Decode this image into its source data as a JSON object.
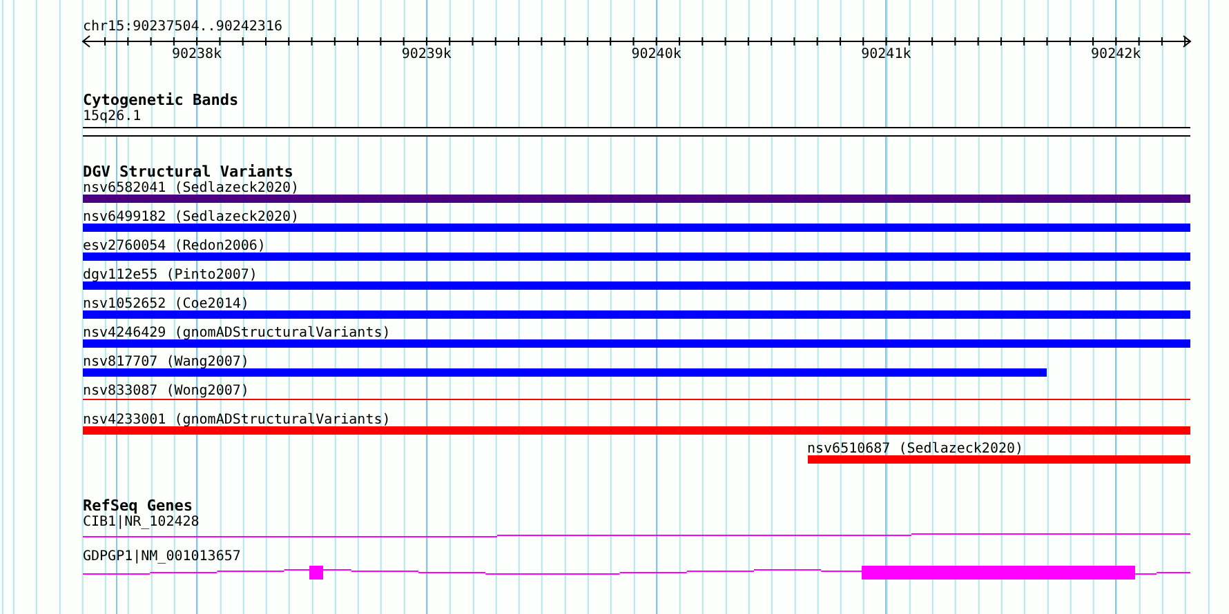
{
  "ruler": {
    "location": "chr15:90237504..90242316",
    "ticks": [
      "90238k",
      "90239k",
      "90240k",
      "90241k",
      "90242k"
    ]
  },
  "cytobands": {
    "title": "Cytogenetic Bands",
    "bands": [
      {
        "name": "15q26.1"
      }
    ]
  },
  "dgv": {
    "title": "DGV Structural Variants",
    "variants": [
      {
        "label": "nsv6582041 (Sedlazeck2020)",
        "color": "#4b0082",
        "kind": "bar"
      },
      {
        "label": "nsv6499182 (Sedlazeck2020)",
        "color": "#0000ff",
        "kind": "bar"
      },
      {
        "label": "esv2760054 (Redon2006)",
        "color": "#0000ff",
        "kind": "bar"
      },
      {
        "label": "dgv112e55 (Pinto2007)",
        "color": "#0000ff",
        "kind": "bar"
      },
      {
        "label": "nsv1052652 (Coe2014)",
        "color": "#0000ff",
        "kind": "bar"
      },
      {
        "label": "nsv4246429 (gnomADStructuralVariants)",
        "color": "#0000ff",
        "kind": "bar"
      },
      {
        "label": "nsv817707 (Wang2007)",
        "color": "#0000ff",
        "kind": "bar"
      },
      {
        "label": "nsv833087 (Wong2007)",
        "color": "#ff0000",
        "kind": "line"
      },
      {
        "label": "nsv4233001 (gnomADStructuralVariants)",
        "color": "#ff0000",
        "kind": "bar"
      },
      {
        "label": "nsv6510687 (Sedlazeck2020)",
        "color": "#ff0000",
        "kind": "bar"
      }
    ]
  },
  "refseq": {
    "title": "RefSeq Genes",
    "genes": [
      {
        "label": "CIB1|NR_102428",
        "kind": "noncoding"
      },
      {
        "label": "GDPGP1|NM_001013657",
        "kind": "coding"
      }
    ]
  }
}
